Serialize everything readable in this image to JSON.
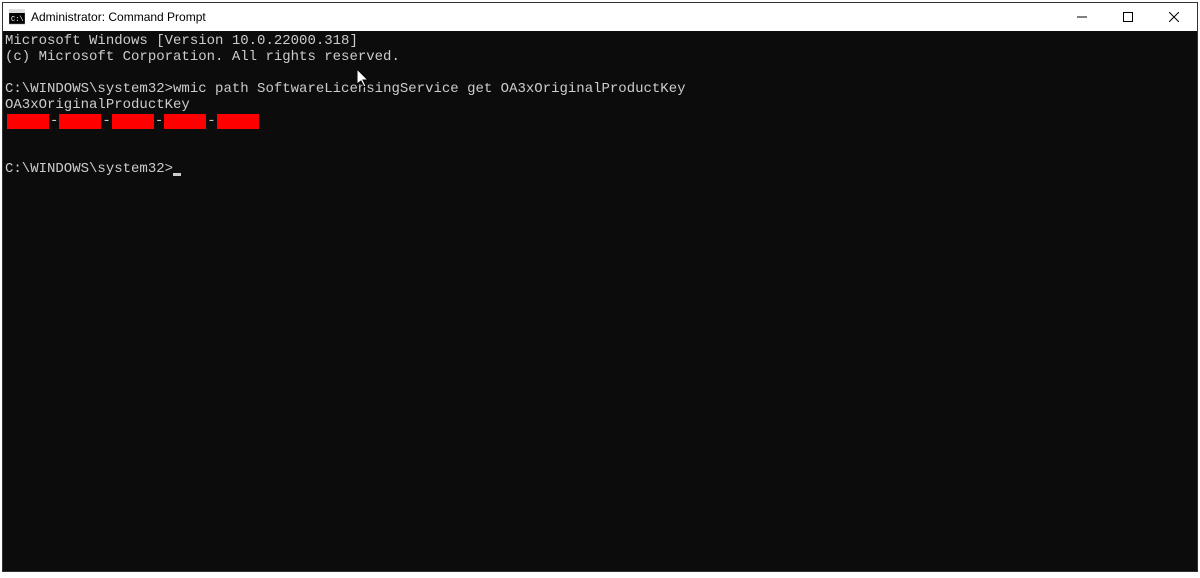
{
  "titlebar": {
    "title": "Administrator: Command Prompt"
  },
  "terminal": {
    "line1": "Microsoft Windows [Version 10.0.22000.318]",
    "line2": "(c) Microsoft Corporation. All rights reserved.",
    "prompt1_path": "C:\\WINDOWS\\system32>",
    "command1": "wmic path SoftwareLicensingService get OA3xOriginalProductKey",
    "output_header": "OA3xOriginalProductKey",
    "prompt2_path": "C:\\WINDOWS\\system32>",
    "key_segments": 5
  }
}
